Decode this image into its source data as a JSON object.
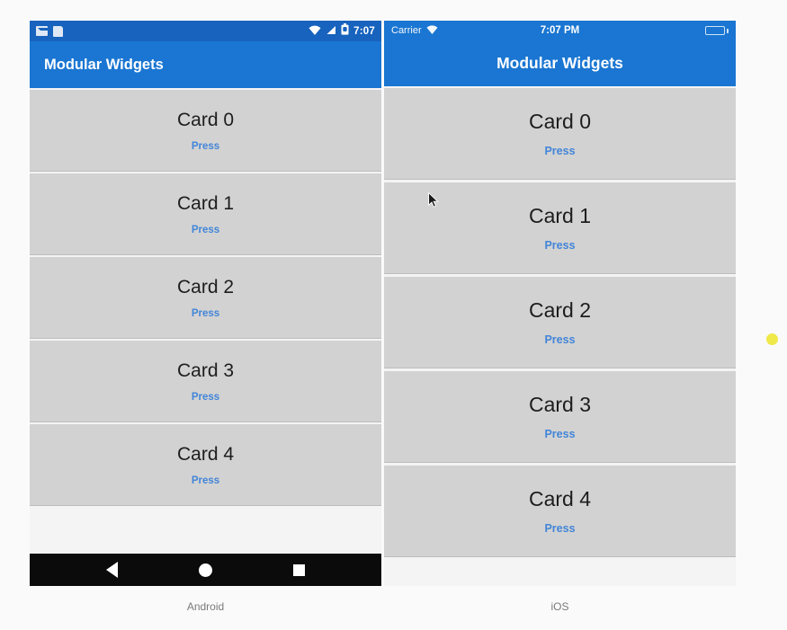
{
  "page": {
    "background_color": "#fafafa",
    "accent_color": "#1a76d2",
    "card_color": "#d2d2d2",
    "press_link_color": "#4285d8"
  },
  "android": {
    "caption": "Android",
    "statusbar": {
      "notification_icons": [
        "mail-icon",
        "document-icon"
      ],
      "wifi_icon": "wifi-icon",
      "signal_icon": "signal-bars-icon",
      "battery_icon": "battery-icon",
      "time": "7:07"
    },
    "appbar": {
      "title": "Modular Widgets"
    },
    "cards": [
      {
        "title": "Card 0",
        "action": "Press"
      },
      {
        "title": "Card 1",
        "action": "Press"
      },
      {
        "title": "Card 2",
        "action": "Press"
      },
      {
        "title": "Card 3",
        "action": "Press"
      },
      {
        "title": "Card 4",
        "action": "Press"
      }
    ],
    "navbar": {
      "back_icon": "back-triangle-icon",
      "home_icon": "home-circle-icon",
      "recents_icon": "recents-square-icon"
    }
  },
  "ios": {
    "caption": "iOS",
    "statusbar": {
      "carrier": "Carrier",
      "wifi_icon": "wifi-icon",
      "time": "7:07 PM",
      "battery_icon": "battery-icon",
      "battery_color": "#2fc84a"
    },
    "appbar": {
      "title": "Modular Widgets"
    },
    "cards": [
      {
        "title": "Card 0",
        "action": "Press"
      },
      {
        "title": "Card 1",
        "action": "Press"
      },
      {
        "title": "Card 2",
        "action": "Press"
      },
      {
        "title": "Card 3",
        "action": "Press"
      },
      {
        "title": "Card 4",
        "action": "Press"
      }
    ]
  },
  "overlays": {
    "cursor": "mouse-pointer-icon",
    "indicator_dot_color": "#efe94a"
  }
}
